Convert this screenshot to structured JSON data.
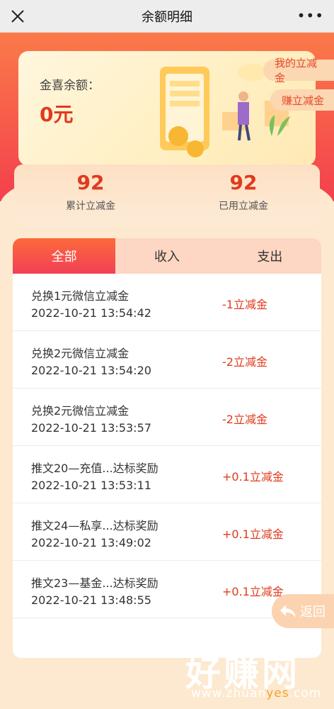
{
  "nav": {
    "title": "余额明细",
    "more": "•••"
  },
  "balance": {
    "label": "金喜余额：",
    "value": "0元"
  },
  "pills": {
    "my_coupons": "我的立减金",
    "earn_coupons": "赚立减金"
  },
  "stats": [
    {
      "num": "92",
      "label": "累计立减金"
    },
    {
      "num": "92",
      "label": "已用立减金"
    }
  ],
  "tabs": [
    {
      "label": "全部",
      "active": true
    },
    {
      "label": "收入"
    },
    {
      "label": "支出"
    }
  ],
  "records": [
    {
      "title": "兑换1元微信立减金",
      "time": "2022-10-21 13:54:42",
      "amount": "-1立减金"
    },
    {
      "title": "兑换2元微信立减金",
      "time": "2022-10-21 13:54:20",
      "amount": "-2立减金"
    },
    {
      "title": "兑换2元微信立减金",
      "time": "2022-10-21 13:53:57",
      "amount": "-2立减金"
    },
    {
      "title": "推文20—充值...达标奖励",
      "time": "2022-10-21 13:53:11",
      "amount": "+0.1立减金"
    },
    {
      "title": "推文24—私享...达标奖励",
      "time": "2022-10-21 13:49:02",
      "amount": "+0.1立减金"
    },
    {
      "title": "推文23—基金...达标奖励",
      "time": "2022-10-21 13:48:55",
      "amount": "+0.1立减金"
    }
  ],
  "back": {
    "label": "返回"
  },
  "watermark": {
    "text": "好赚网",
    "url_a": "www.zhuan",
    "url_b": "yes",
    "url_c": ".com"
  },
  "colors": {
    "accent": "#e03a1e",
    "header_start": "#fb7a4a",
    "header_end": "#f3404c",
    "background": "#fde9cf"
  }
}
